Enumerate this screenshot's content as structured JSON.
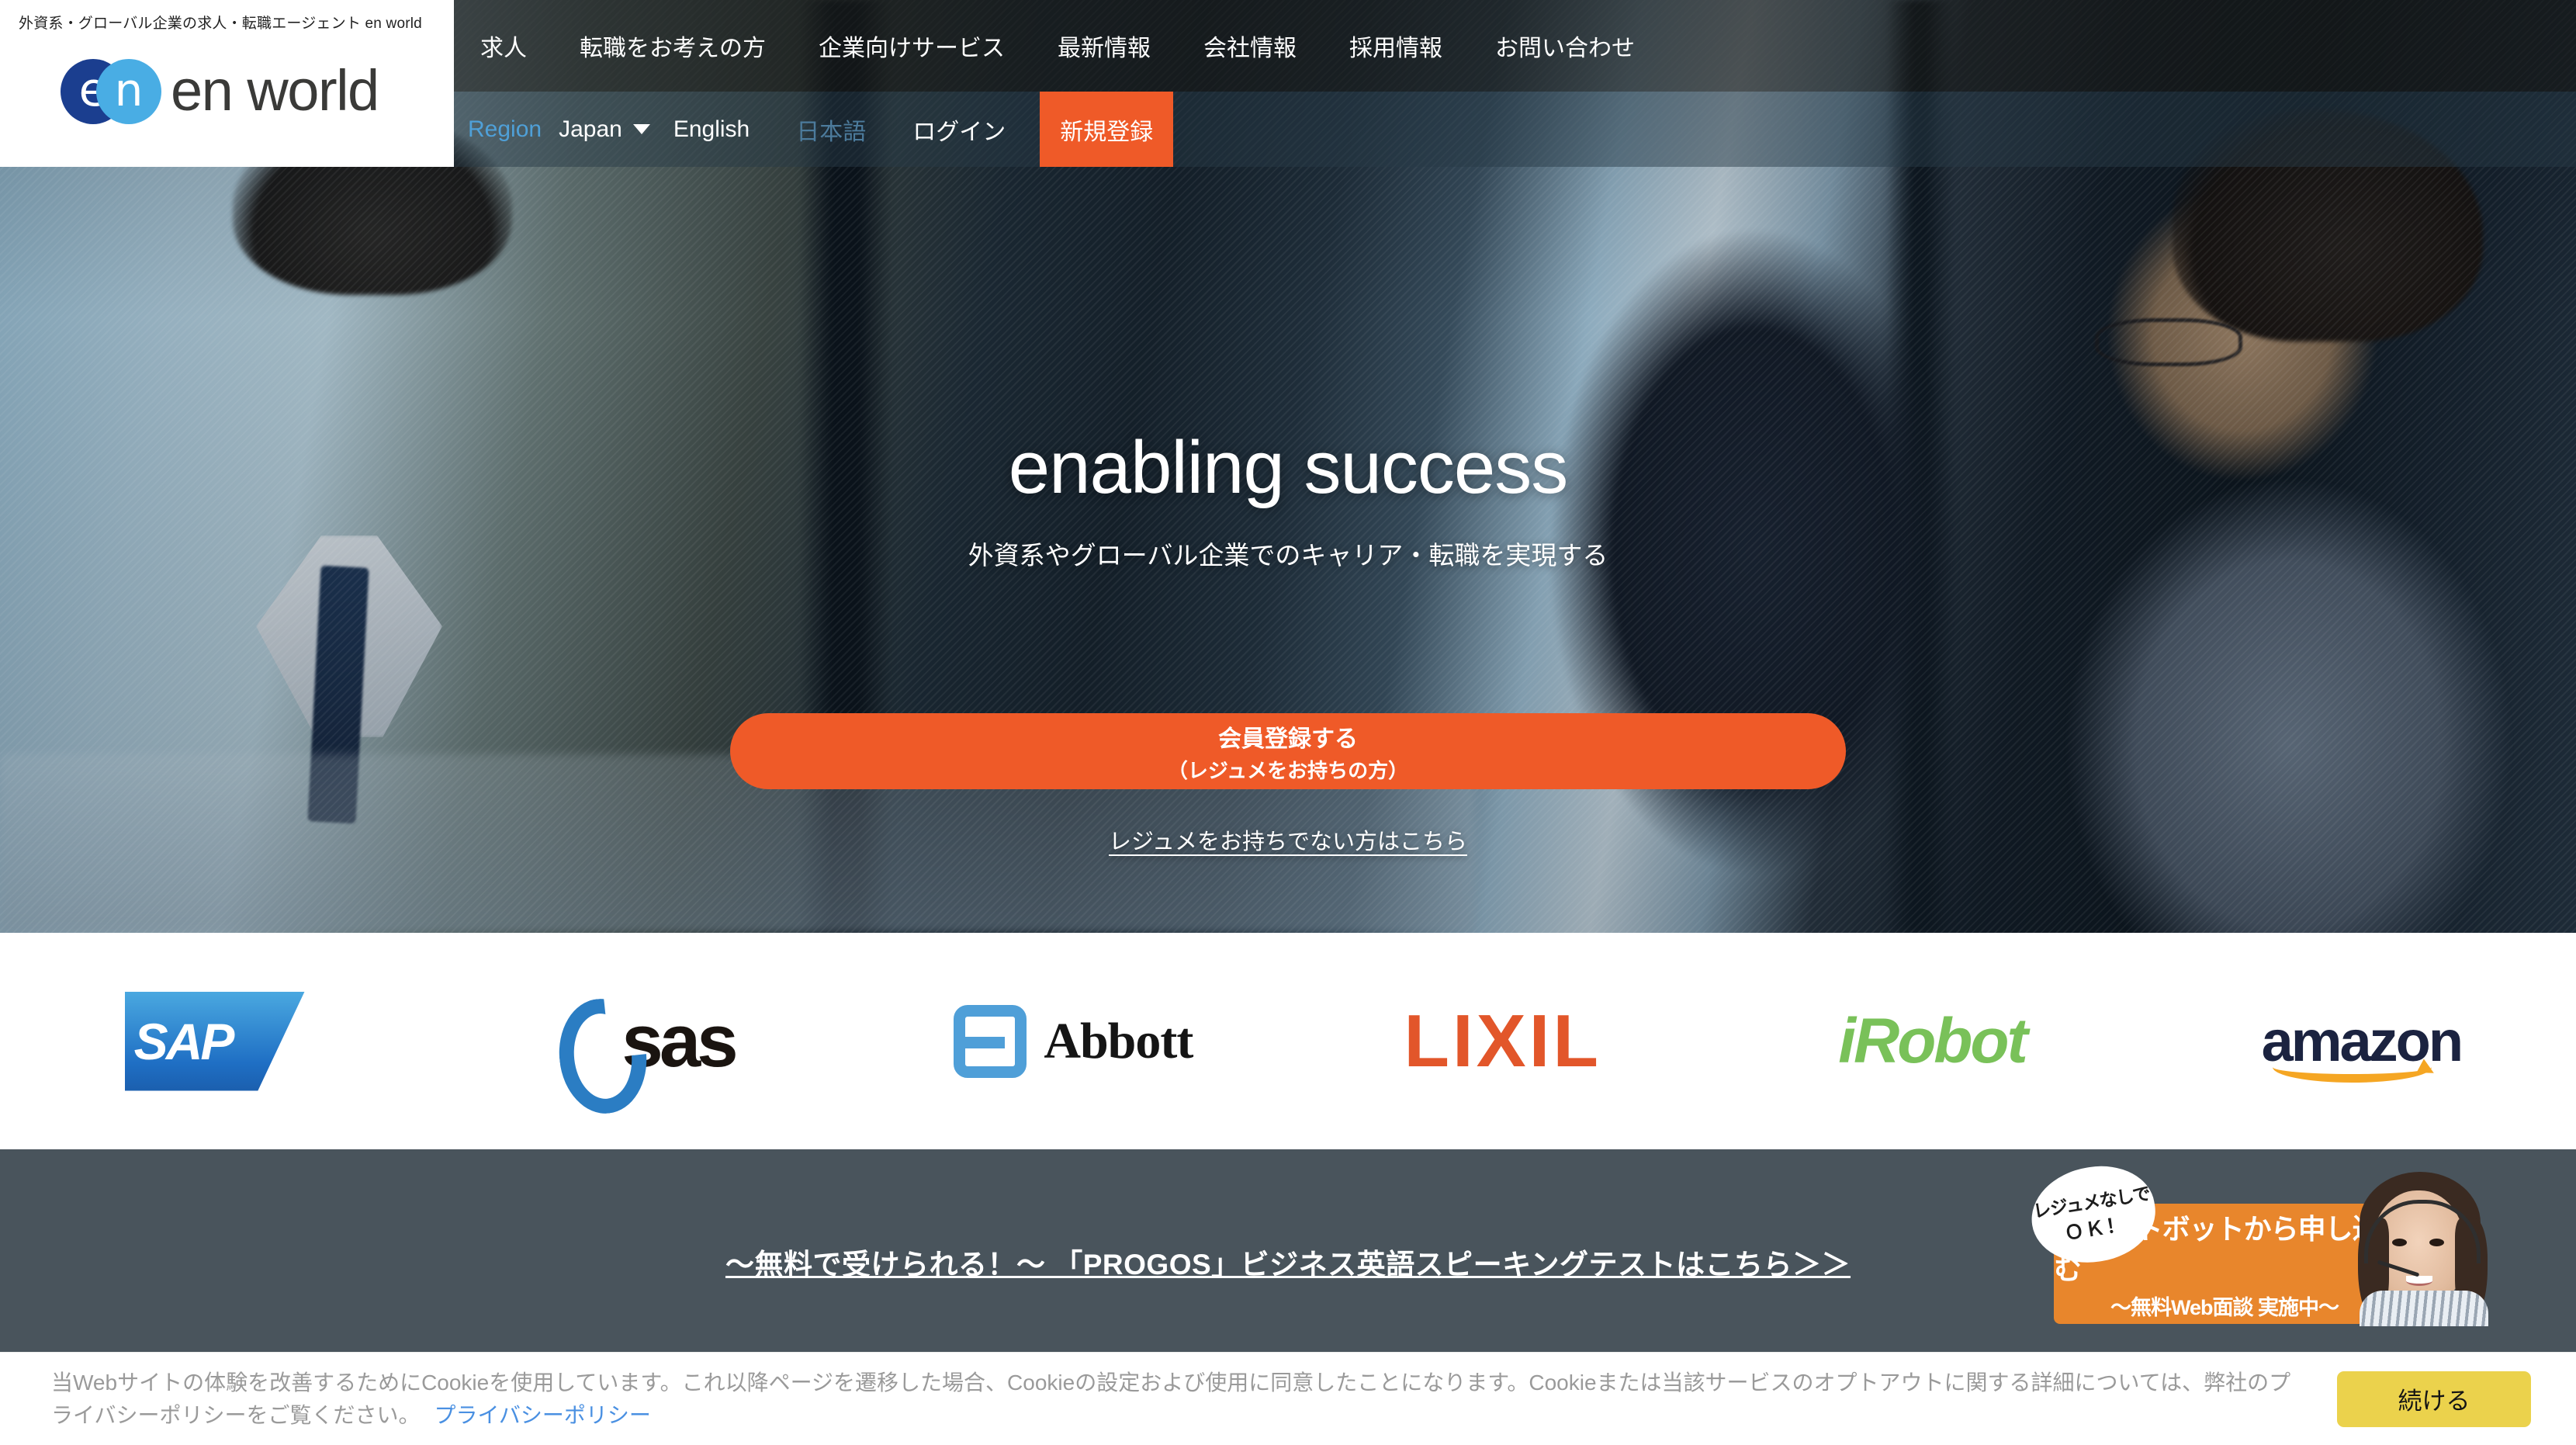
{
  "brand": {
    "tagline": "外資系・グローバル企業の求人・転職エージェント en world",
    "logo_mark_left": "e",
    "logo_mark_right": "n",
    "logo_text": "en world",
    "accent_orange": "#ef5a28",
    "accent_blue": "#49ade4",
    "accent_navy": "#1b3e8f"
  },
  "nav": {
    "primary": [
      {
        "label": "求人"
      },
      {
        "label": "転職をお考えの方"
      },
      {
        "label": "企業向けサービス"
      },
      {
        "label": "最新情報"
      },
      {
        "label": "会社情報"
      },
      {
        "label": "採用情報"
      },
      {
        "label": "お問い合わせ"
      }
    ],
    "region_label": "Region",
    "region_value": "Japan",
    "lang_en": "English",
    "lang_ja": "日本語",
    "login": "ログイン",
    "signup": "新規登録"
  },
  "hero": {
    "title": "enabling success",
    "subtitle": "外資系やグローバル企業でのキャリア・転職を実現する",
    "cta_main": "会員登録する",
    "cta_note": "（レジュメをお持ちの方）",
    "cta_link": "レジュメをお持ちでない方はこちら"
  },
  "clients": [
    {
      "name": "SAP",
      "text": "SAP",
      "color": "#1f6fc4"
    },
    {
      "name": "SAS",
      "text": "sas",
      "color": "#2b7dc3"
    },
    {
      "name": "Abbott",
      "text": "Abbott",
      "color": "#4f9fd8"
    },
    {
      "name": "LIXIL",
      "text": "LIXIL",
      "color": "#e2562a"
    },
    {
      "name": "iRobot",
      "text": "iRobot",
      "color": "#79c159"
    },
    {
      "name": "amazon",
      "text": "amazon",
      "color": "#1b2340"
    }
  ],
  "promo": {
    "banner_text": "〜無料で受けられる！〜 「PROGOS」ビジネス英語スピーキングテストはこちら＞＞",
    "chatbot": {
      "bubble_line1": "レジュメなしで",
      "bubble_line2": "ＯＫ！",
      "panel_line1": "チャットボットから申し込む",
      "panel_line2": "〜無料Web面談 実施中〜"
    }
  },
  "cookie": {
    "message": "当Webサイトの体験を改善するためにCookieを使用しています。これ以降ページを遷移した場合、Cookieの設定および使用に同意したことになります。Cookieまたは当該サービスのオプトアウトに関する詳細については、弊社のプライバシーポリシーをご覧ください。",
    "policy_link": "プライバシーポリシー",
    "accept_button": "続ける"
  }
}
